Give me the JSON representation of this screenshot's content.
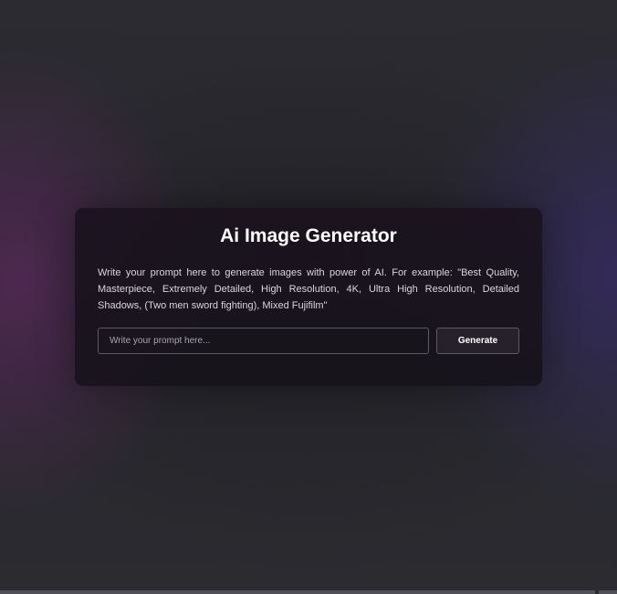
{
  "card": {
    "title": "Ai Image Generator",
    "description": "Write your prompt here to generate images with power of AI. For example: \"Best Quality, Masterpiece, Extremely Detailed, High Resolution, 4K, Ultra High Resolution, Detailed Shadows, (Two men sword fighting), Mixed Fujifilm\"",
    "prompt": {
      "value": "",
      "placeholder": "Write your prompt here..."
    },
    "generate_label": "Generate"
  },
  "colors": {
    "background": "#2a2a30",
    "card": "#1a121e",
    "text": "#ffffff",
    "border": "#5c5a62"
  }
}
